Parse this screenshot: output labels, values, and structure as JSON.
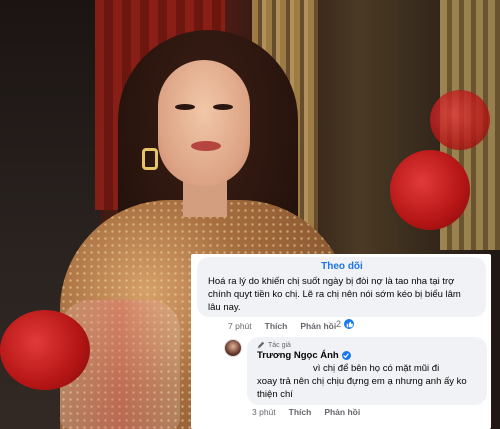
{
  "comments": [
    {
      "follow_label": "Theo dõi",
      "text": "Hoá ra lý do khiến chị suốt ngày bị đòi nợ là tao nha tại trợ chính quyt tiền ko chị. Lẽ ra chị nên nói sớm kéo bị biểu lâm lâu nay.",
      "time": "7 phút",
      "like_label": "Thích",
      "reply_label": "Phản hồi",
      "reaction_count": "2",
      "reaction_icon": "like-icon"
    },
    {
      "author_badge": "Tác giả",
      "author_name": "Trương Ngọc Ánh",
      "verified_icon": "verified-badge-icon",
      "text_line1": "vì chị để bên họ có mặt mũi đi",
      "text_rest": "xoay trả nên chị chịu đựng em ạ nhưng anh ấy ko thiện chí",
      "time": "3 phút",
      "like_label": "Thích",
      "reply_label": "Phản hồi"
    }
  ],
  "colors": {
    "link_blue": "#1b74e4",
    "bubble_bg": "#f0f2f5",
    "meta_gray": "#65676b",
    "like_blue": "#1877f2"
  }
}
